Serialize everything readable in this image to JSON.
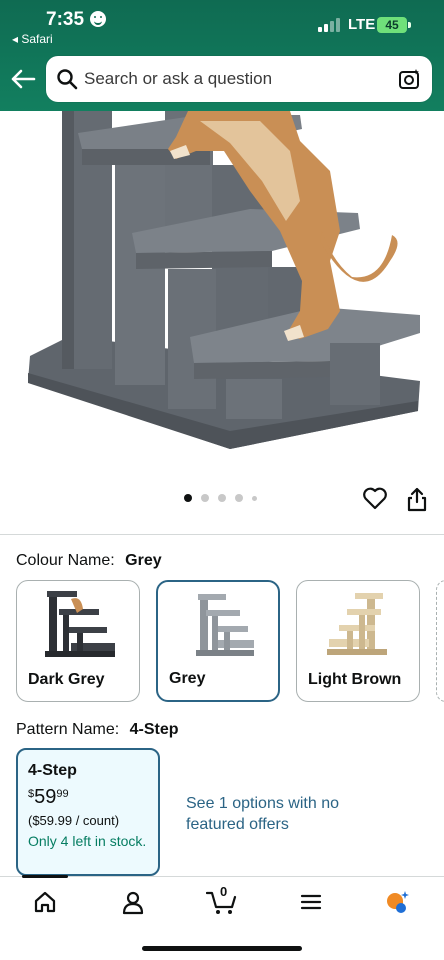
{
  "status_bar": {
    "time": "7:35",
    "back_app": "◂ Safari",
    "network": "LTE",
    "battery": "45"
  },
  "header": {
    "search_placeholder": "Search or ask a question"
  },
  "product_gallery": {
    "image_count": 5,
    "active_index": 0
  },
  "variations": {
    "colour_label": "Colour Name:",
    "colour_value": "Grey",
    "colours": [
      {
        "name": "Dark Grey",
        "selected": false
      },
      {
        "name": "Grey",
        "selected": true
      },
      {
        "name": "Light Brown",
        "selected": false
      }
    ],
    "pattern_label": "Pattern Name:",
    "pattern_value": "4-Step"
  },
  "pattern_option": {
    "title": "4-Step",
    "price_currency": "$",
    "price_whole": "59",
    "price_fraction": "99",
    "unit_price": "($59.99 / count)",
    "stock": "Only 4 left in stock."
  },
  "other_offers": "See 1 options with no featured offers",
  "bottom_nav": {
    "cart_count": "0"
  },
  "colors": {
    "header_green": "#127f5f",
    "selected_border": "#2b6485",
    "link_blue": "#2b6485",
    "stock_green": "#067d62",
    "carpet_grey": "#6b7178",
    "cat_orange": "#c98f55"
  }
}
